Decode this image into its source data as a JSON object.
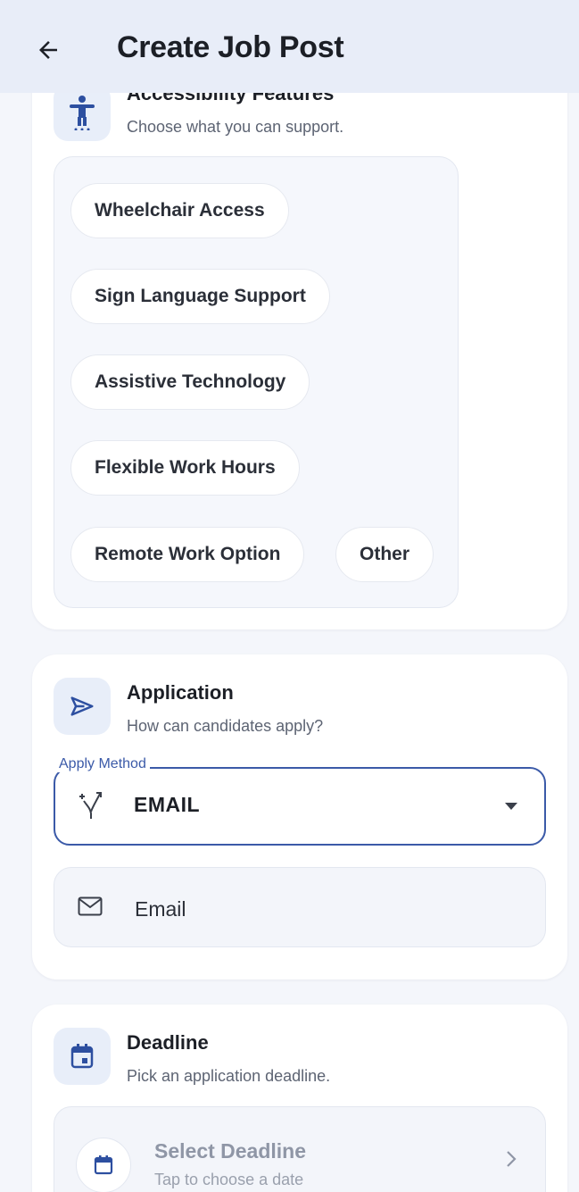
{
  "appbar": {
    "title": "Create Job Post",
    "back_icon": "arrow-back-icon"
  },
  "accessibility": {
    "title": "Accessibility Features",
    "subtitle": "Choose what you can support.",
    "icon": "accessibility-icon",
    "chips": [
      {
        "label": "Wheelchair Access"
      },
      {
        "label": "Sign Language Support"
      },
      {
        "label": "Assistive Technology"
      },
      {
        "label": "Flexible Work Hours"
      },
      {
        "label": "Remote Work Option"
      },
      {
        "label": "Other"
      }
    ]
  },
  "application": {
    "title": "Application",
    "subtitle": "How can candidates apply?",
    "icon": "send-icon",
    "apply_method": {
      "label": "Apply Method",
      "value": "EMAIL",
      "icon": "merge-icon"
    },
    "email_field": {
      "placeholder": "Email",
      "icon": "mail-icon"
    }
  },
  "deadline": {
    "title": "Deadline",
    "subtitle": "Pick an application deadline.",
    "icon": "calendar-icon",
    "select": {
      "title": "Select Deadline",
      "subtitle": "Tap to choose a date"
    }
  },
  "colors": {
    "accent": "#3b5aa8",
    "appbar_bg": "#e8edf8",
    "page_bg": "#f4f6fb"
  }
}
